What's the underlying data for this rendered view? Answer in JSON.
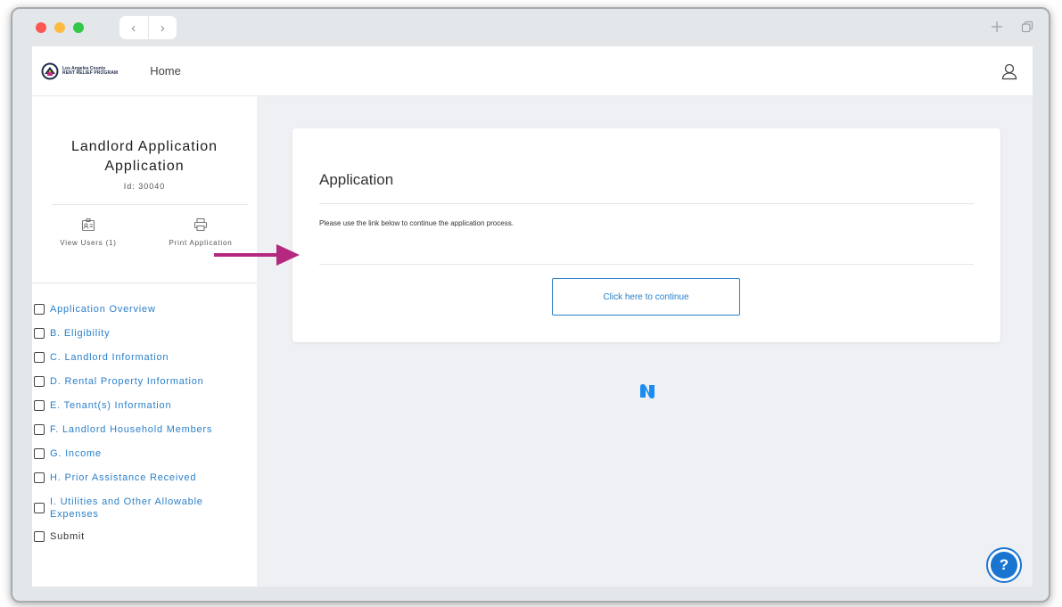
{
  "browser": {
    "back_glyph": "‹",
    "forward_glyph": "›",
    "new_tab_glyph": "+",
    "copy_glyph": "⧉"
  },
  "header": {
    "logo_line1": "Los Angeles County",
    "logo_line2": "RENT RELIEF PROGRAM",
    "home_label": "Home"
  },
  "sidebar": {
    "title": "Landlord Application Application",
    "id_text": "Id: 30040",
    "view_users_label": "View Users (1)",
    "print_label": "Print Application",
    "items": [
      {
        "label": "Application Overview"
      },
      {
        "label": "B. Eligibility"
      },
      {
        "label": "C. Landlord Information"
      },
      {
        "label": "D. Rental Property Information"
      },
      {
        "label": "E. Tenant(s) Information"
      },
      {
        "label": "F. Landlord Household Members"
      },
      {
        "label": "G. Income"
      },
      {
        "label": "H. Prior Assistance Received"
      },
      {
        "label": "I. Utilities and Other Allowable Expenses"
      },
      {
        "label": "Submit"
      }
    ]
  },
  "main": {
    "card_title": "Application",
    "card_text": "Please use the link below to continue the application process.",
    "continue_label": "Click here to continue",
    "help_glyph": "?"
  },
  "colors": {
    "link_blue": "#2a7fc8",
    "arrow_magenta": "#b5287f",
    "help_blue": "#1a75d1"
  }
}
